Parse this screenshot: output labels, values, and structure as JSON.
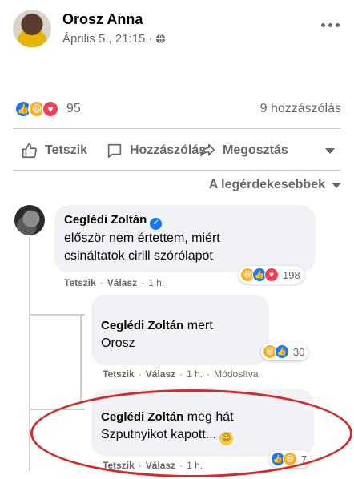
{
  "post": {
    "author": "Orosz Anna",
    "date": "Április 5., 21:15",
    "separator": "·",
    "privacy_icon": "globe-icon"
  },
  "stats": {
    "reactions": [
      "like",
      "haha",
      "love"
    ],
    "reaction_count": "95",
    "comment_count": "9 hozzászólás"
  },
  "actions": {
    "like": "Tetszik",
    "comment": "Hozzászólás",
    "share": "Megosztás"
  },
  "sort": {
    "label": "A legérdekesebbek"
  },
  "comments": [
    {
      "author": "Ceglédi Zoltán",
      "verified": true,
      "text_line1": "először nem értettem, miért",
      "text_line2": "csináltatok cirill szórólapot",
      "like": "Tetszik",
      "reply": "Válasz",
      "time": "1 h.",
      "reaction_count": "198",
      "reactions": [
        "haha",
        "like",
        "love"
      ]
    },
    {
      "author": "Ceglédi Zoltán",
      "text_line1": "mert",
      "text_line2": "Orosz",
      "like": "Tetszik",
      "reply": "Válasz",
      "time": "1 h.",
      "edited": "Módosítva",
      "reaction_count": "30",
      "reactions": [
        "haha",
        "like"
      ]
    },
    {
      "author": "Ceglédi Zoltán",
      "text_line1": "meg hát",
      "text_line2": "Szputnyikot kapott...",
      "emoji": "😉",
      "like": "Tetszik",
      "reply": "Válasz",
      "time": "1 h.",
      "reaction_count": "7",
      "reactions": [
        "like",
        "haha"
      ]
    }
  ],
  "colors": {
    "facebook_blue": "#1877f2",
    "secondary_text": "#65676b",
    "bubble_bg": "#f0f2f5",
    "highlight_red": "#d42a2a"
  }
}
